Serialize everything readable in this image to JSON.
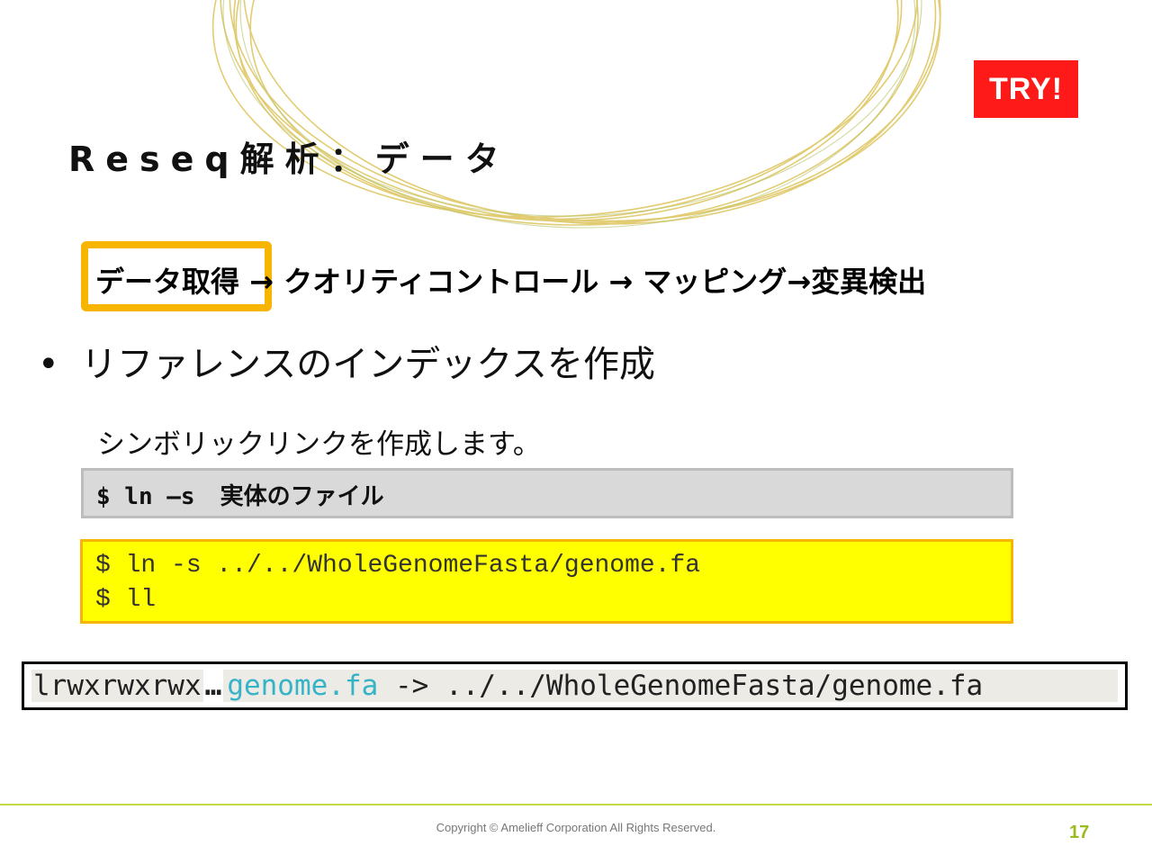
{
  "badge": {
    "label": "TRY!",
    "color": "#ff1a1a"
  },
  "title": "Reseq解析：データ",
  "flow": {
    "step1": "データ取得",
    "arrow1": " → ",
    "step2": "クオリティコントロール",
    "arrow2": " → ",
    "step3": "マッピング",
    "arrow3": "→",
    "step4": "変異検出",
    "highlight_color": "#f7b400"
  },
  "bullet": {
    "marker": "•",
    "text": "リファレンスのインデックスを作成"
  },
  "subtext": "シンボリックリンクを作成します。",
  "syntax": {
    "command": "$ ln –s",
    "argument": "実体のファイル"
  },
  "example": {
    "lines": [
      "$ ln -s ../../WholeGenomeFasta/genome.fa",
      "$ ll"
    ],
    "background": "#ffff00"
  },
  "terminal": {
    "permissions": "lrwxrwxrwx",
    "ellipsis": "…",
    "link_name": "genome.fa",
    "arrow": " -> ",
    "target": "../../WholeGenomeFasta/genome.fa",
    "link_color": "#35b3c7"
  },
  "footer": {
    "copyright": "Copyright © Amelieff Corporation All Rights Reserved.",
    "page_number": "17",
    "accent": "#9bbb1c"
  }
}
